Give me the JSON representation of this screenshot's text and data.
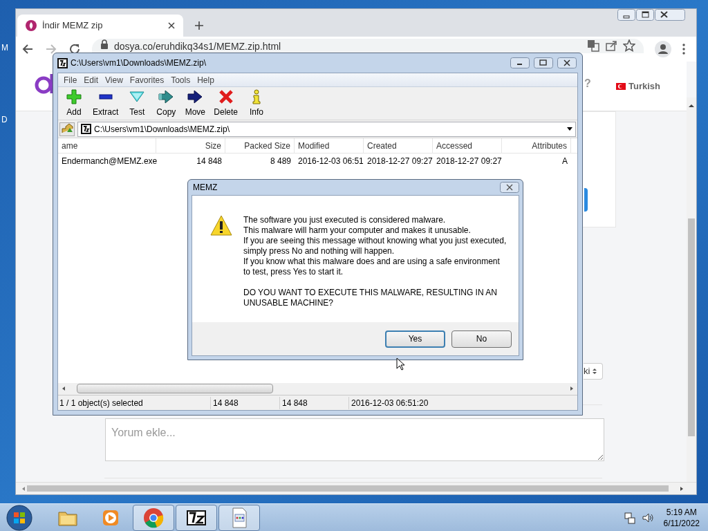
{
  "desktop": {
    "icon_labels": [
      "M",
      "D"
    ]
  },
  "browser": {
    "tabs": [
      {
        "title": "İndir MEMZ zip",
        "selected": true
      }
    ],
    "url": "dosya.co/eruhdikq34s1/MEMZ.zip.html",
    "page": {
      "help_mark": "?",
      "language": "Turkish",
      "select_value": "ki",
      "comment": {
        "placeholder": "Yorum ekle..."
      }
    }
  },
  "archiver": {
    "title": "C:\\Users\\vm1\\Downloads\\MEMZ.zip\\",
    "menu": [
      "File",
      "Edit",
      "View",
      "Favorites",
      "Tools",
      "Help"
    ],
    "toolbar": [
      {
        "label": "Add",
        "kind": "add"
      },
      {
        "label": "Extract",
        "kind": "extract"
      },
      {
        "label": "Test",
        "kind": "test"
      },
      {
        "label": "Copy",
        "kind": "copy"
      },
      {
        "label": "Move",
        "kind": "move"
      },
      {
        "label": "Delete",
        "kind": "delete"
      },
      {
        "label": "Info",
        "kind": "info"
      }
    ],
    "path": "C:\\Users\\vm1\\Downloads\\MEMZ.zip\\",
    "columns": [
      "ame",
      "Size",
      "Packed Size",
      "Modified",
      "Created",
      "Accessed",
      "Attributes"
    ],
    "rows": [
      {
        "cells": [
          "Endermanch@MEMZ.exe",
          "14 848",
          "8 489",
          "2016-12-03 06:51",
          "2018-12-27 09:27",
          "2018-12-27 09:27",
          "A"
        ]
      }
    ],
    "status": [
      "1 / 1 object(s) selected",
      "14 848",
      "14 848",
      "2016-12-03 06:51:20"
    ]
  },
  "dialog": {
    "title": "MEMZ",
    "message": [
      "The software you just executed is considered malware.",
      "This malware will harm your computer and makes it unusable.",
      "If you are seeing this message without knowing what you just executed,",
      "simply press No and nothing will happen.",
      "If you know what this malware does and are using a safe environment",
      "to test, press Yes to start it."
    ],
    "question": [
      "DO YOU WANT TO EXECUTE THIS MALWARE, RESULTING IN AN",
      "UNUSABLE MACHINE?"
    ],
    "buttons": [
      {
        "label": "Yes",
        "default": true
      },
      {
        "label": "No",
        "default": false
      }
    ]
  },
  "taskbar": {
    "apps": [
      {
        "kind": "folder",
        "open": false
      },
      {
        "kind": "media",
        "open": false
      },
      {
        "kind": "browser",
        "open": true
      },
      {
        "kind": "archiver",
        "open": true
      },
      {
        "kind": "document",
        "open": true
      }
    ],
    "time": "5:19 AM",
    "date": "6/11/2022"
  }
}
